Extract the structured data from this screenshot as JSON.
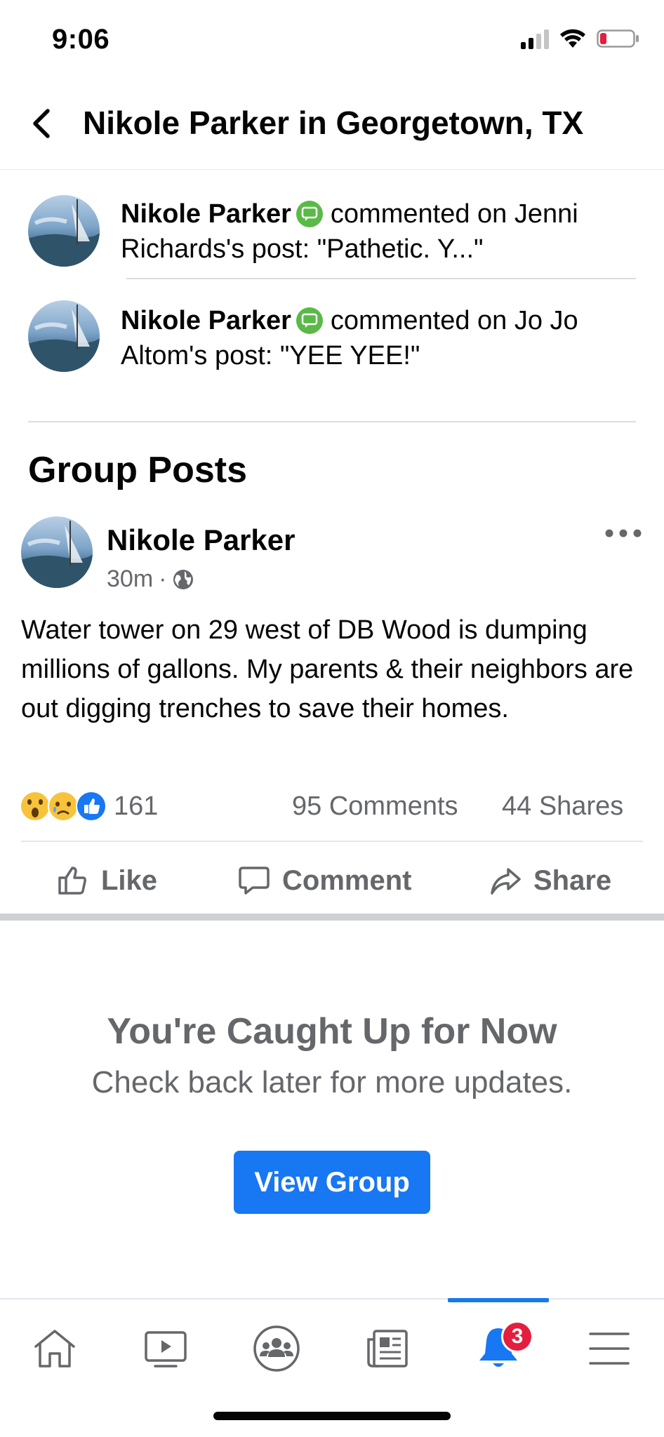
{
  "status_bar": {
    "time": "9:06"
  },
  "header": {
    "title": "Nikole Parker in Georgetown, TX"
  },
  "activity": [
    {
      "name": "Nikole Parker",
      "text": "commented on Jenni Richards's post: \"Pathetic. Y...\""
    },
    {
      "name": "Nikole Parker",
      "text": "commented on Jo Jo Altom's post: \"YEE YEE!\""
    }
  ],
  "group_posts": {
    "title": "Group Posts",
    "post": {
      "author": "Nikole Parker",
      "time": "30m",
      "separator": "·",
      "body": "Water tower on 29 west of DB Wood is dumping millions of gallons. My parents & their neighbors are out digging trenches to save their homes.",
      "reaction_count": "161",
      "comments": "95 Comments",
      "shares": "44 Shares",
      "actions": {
        "like": "Like",
        "comment": "Comment",
        "share": "Share"
      }
    }
  },
  "caught_up": {
    "title": "You're Caught Up for Now",
    "subtitle": "Check back later for more updates.",
    "button": "View Group"
  },
  "tab_bar": {
    "tabs": [
      "home-icon",
      "watch-icon",
      "groups-icon",
      "news-icon",
      "notifications-icon",
      "menu-icon"
    ],
    "active": "notifications-icon",
    "notification_badge": "3"
  },
  "colors": {
    "brand": "#1877f2",
    "badge": "#e41e3f",
    "secondary_text": "#65676b"
  }
}
